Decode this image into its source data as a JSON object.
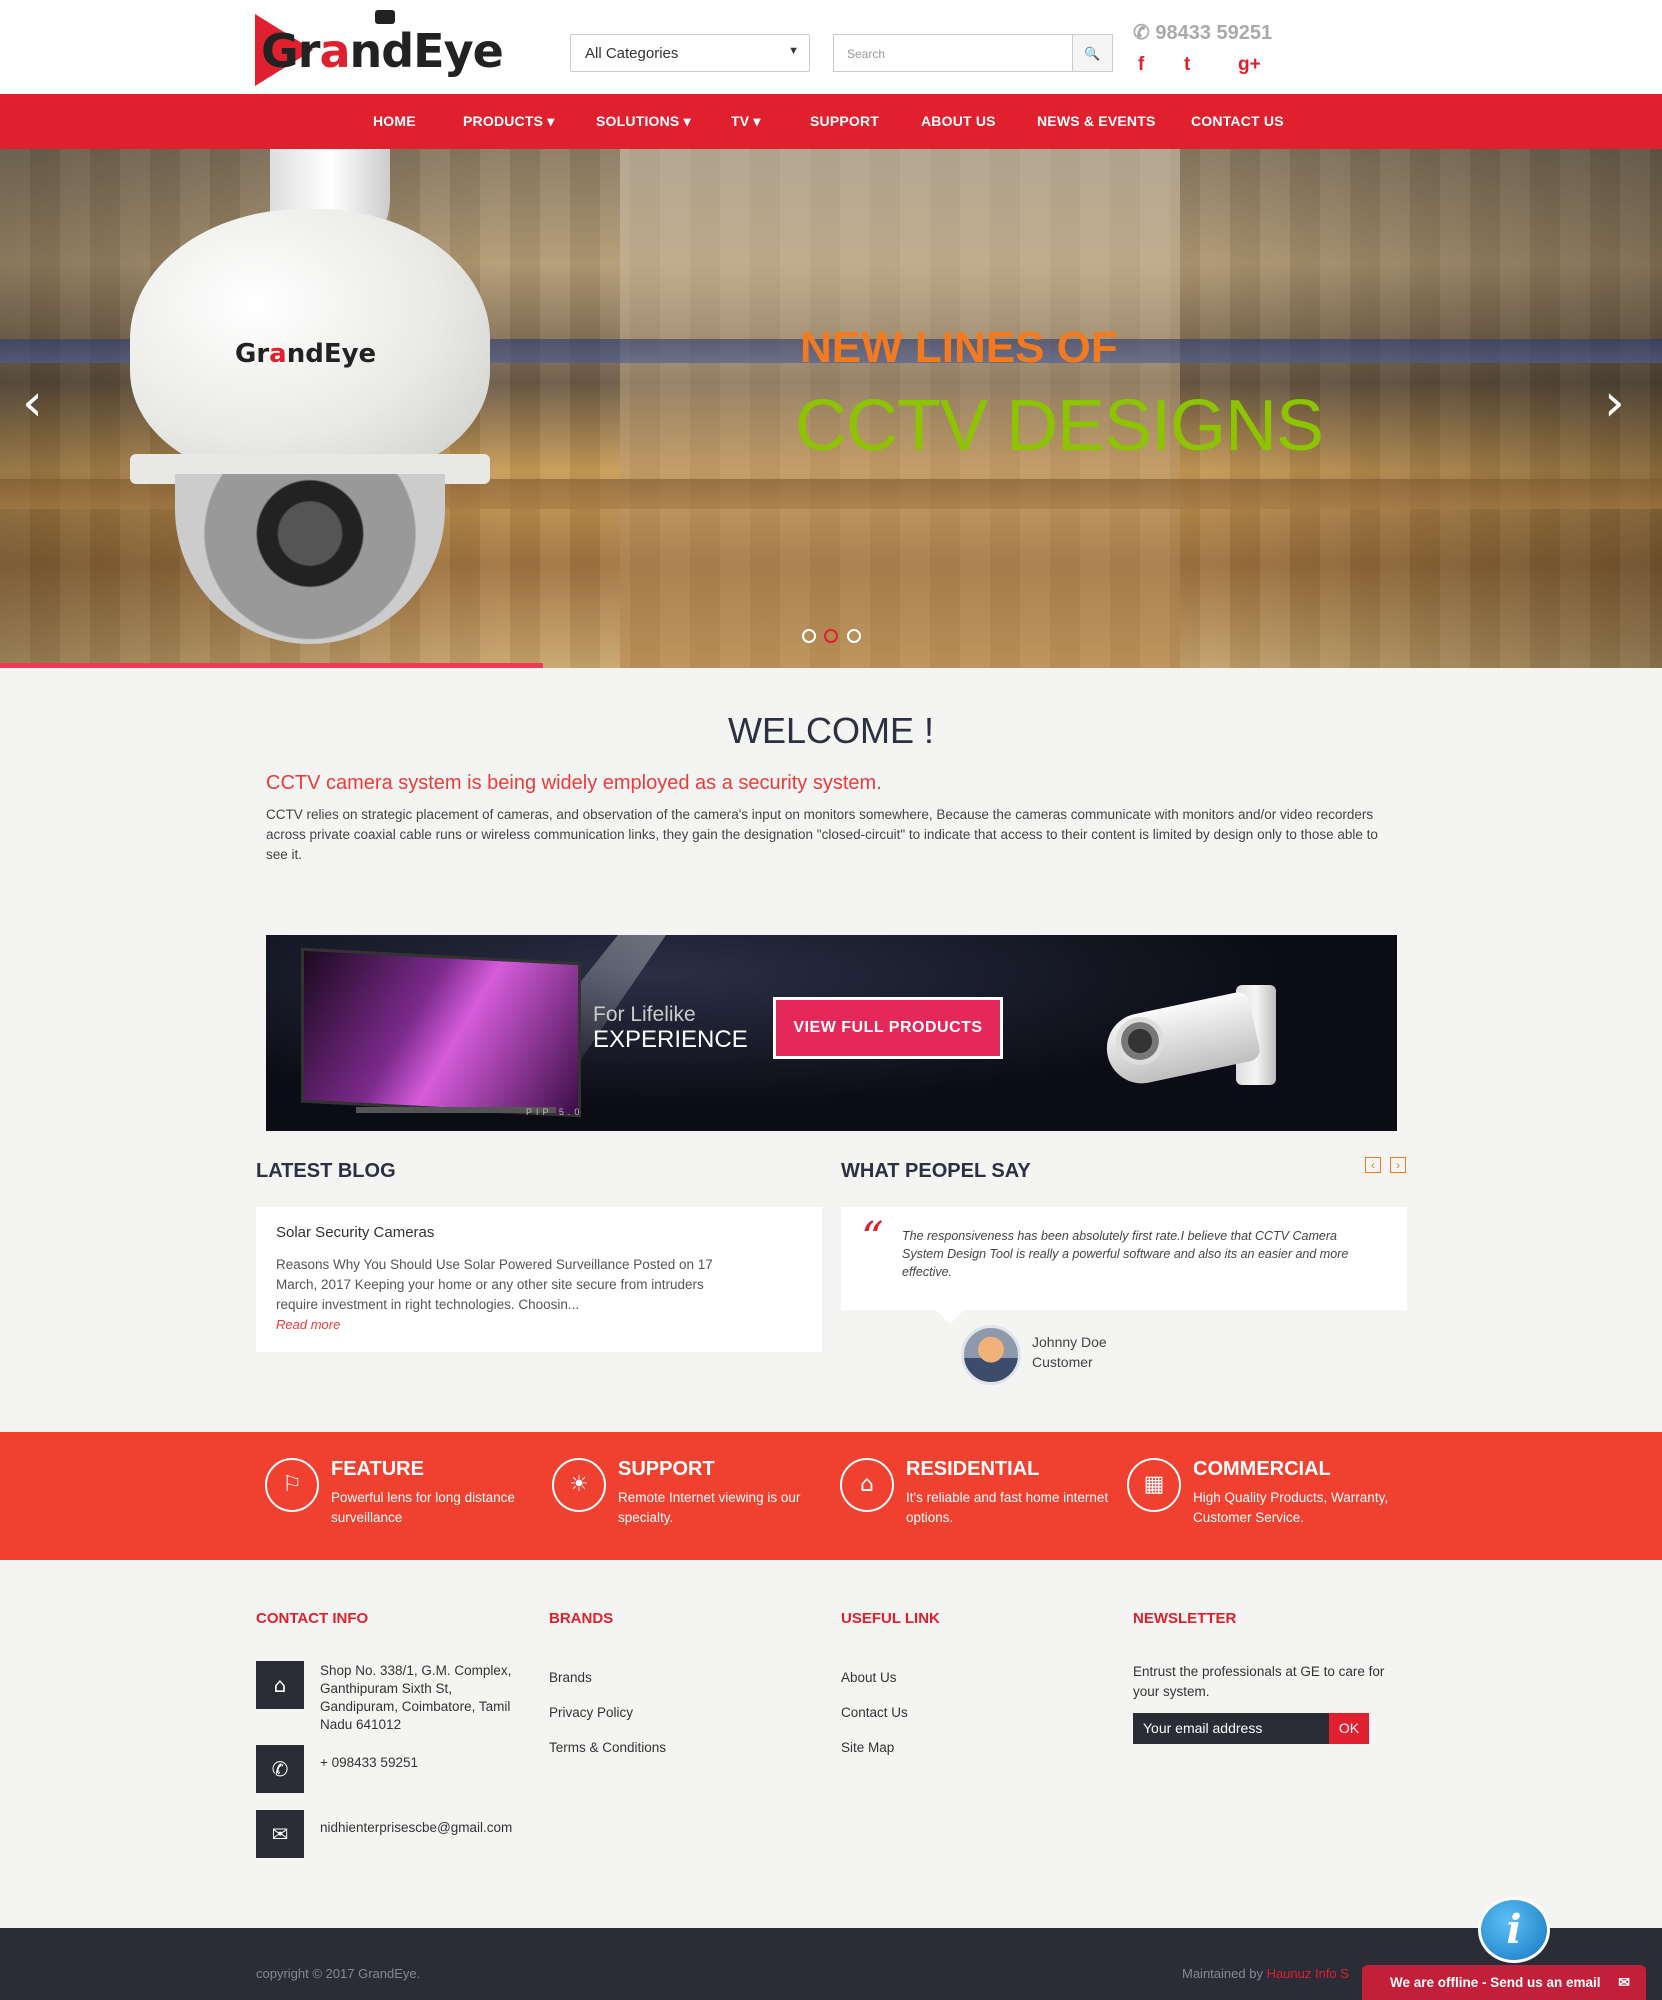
{
  "brand": {
    "logo_text_a": "Gr",
    "logo_text_b": "a",
    "logo_text_c": "ndEye"
  },
  "header": {
    "category": "All Categories",
    "search_placeholder": "Search",
    "phone": "98433 59251",
    "social": [
      "f",
      "t",
      "g+"
    ]
  },
  "nav": [
    "HOME",
    "PRODUCTS",
    "SOLUTIONS",
    "TV",
    "SUPPORT",
    "ABOUT US",
    "NEWS & EVENTS",
    "CONTACT US"
  ],
  "hero": {
    "line1": "NEW LINES OF",
    "line2": "CCTV DESIGNS",
    "slides": 3,
    "active_slide": 2,
    "progress": 0.33
  },
  "welcome": {
    "title": "WELCOME !",
    "subtitle": "CCTV camera system is being widely employed as a security system.",
    "body": "CCTV relies on strategic placement of cameras, and observation of the camera's input on monitors somewhere, Because the cameras communicate with monitors and/or video recorders across private coaxial cable runs or wireless communication links, they gain the designation \"closed-circuit\" to indicate that access to their content is limited by design only to those able to see it."
  },
  "banner": {
    "line1": "For Lifelike",
    "line2": "EXPERIENCE",
    "button": "VIEW FULL PRODUCTS",
    "badges": "PIP  5.0"
  },
  "blog": {
    "heading": "LATEST BLOG",
    "title": "Solar Security Cameras",
    "excerpt": "Reasons Why You Should Use Solar Powered Surveillance Posted on 17 March, 2017 Keeping your home or any other site secure from intruders require investment in right technologies. Choosin...",
    "more": "Read more"
  },
  "testimonial": {
    "heading": "WHAT PEOPEL SAY",
    "quote": "The responsiveness has been absolutely first rate.I believe that CCTV Camera System Design Tool is really a powerful software and also its an easier and more effective.",
    "name": "Johnny Doe",
    "role": "Customer"
  },
  "features": [
    {
      "title": "FEATURE",
      "desc": "Powerful lens for long distance surveillance",
      "icon": "tag-icon"
    },
    {
      "title": "SUPPORT",
      "desc": "Remote Internet viewing is our specialty.",
      "icon": "bulb-icon"
    },
    {
      "title": "RESIDENTIAL",
      "desc": "It's reliable and fast home internet options.",
      "icon": "home-icon"
    },
    {
      "title": "COMMERCIAL",
      "desc": "High Quality Products, Warranty, Customer Service.",
      "icon": "building-icon"
    }
  ],
  "footer": {
    "contact_heading": "CONTACT INFO",
    "address": "Shop No. 338/1, G.M. Complex, Ganthipuram Sixth St, Gandipuram, Coimbatore, Tamil Nadu 641012",
    "phone": "+ 098433 59251",
    "email": "nidhienterprisescbe@gmail.com",
    "brands_heading": "BRANDS",
    "brands_links": [
      "Brands",
      "Privacy Policy",
      "Terms & Conditions"
    ],
    "useful_heading": "USEFUL LINK",
    "useful_links": [
      "About Us",
      "Contact Us",
      "Site Map"
    ],
    "newsletter_heading": "NEWSLETTER",
    "newsletter_text": "Entrust the professionals at GE to care for your system.",
    "newsletter_placeholder": "Your email address",
    "newsletter_button": "OK",
    "copyright": "copyright © 2017 GrandEye.",
    "maintained_prefix": "Maintained by ",
    "maintained_brand": "Haunuz Info S"
  },
  "chat": {
    "bubble": "i",
    "text": "We are offline - Send us an email"
  },
  "colors": {
    "accent": "#e0202e",
    "orange": "#f47a20",
    "green": "#8cc400",
    "feature_bg": "#f04030",
    "dark": "#2a2d36"
  }
}
